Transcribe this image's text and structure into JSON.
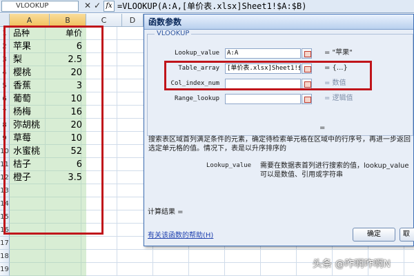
{
  "formula_bar": {
    "name_box": "VLOOKUP",
    "cancel_glyph": "✕",
    "confirm_glyph": "✓",
    "fx_label": "fx",
    "formula": "=VLOOKUP(A:A,[单价表.xlsx]Sheet1!$A:$B)"
  },
  "grid": {
    "columns": [
      "A",
      "B",
      "C",
      "D"
    ],
    "row_numbers": [
      "1",
      "2",
      "3",
      "4",
      "5",
      "6",
      "7",
      "8",
      "9",
      "10",
      "11",
      "12",
      "13",
      "14",
      "15",
      "16",
      "17",
      "18",
      "19"
    ],
    "rows": [
      {
        "a": "品种",
        "b": "单价"
      },
      {
        "a": "苹果",
        "b": "6"
      },
      {
        "a": "梨",
        "b": "2.5"
      },
      {
        "a": "樱桃",
        "b": "20"
      },
      {
        "a": "香蕉",
        "b": "3"
      },
      {
        "a": "葡萄",
        "b": "10"
      },
      {
        "a": "杨梅",
        "b": "16"
      },
      {
        "a": "弥胡桃",
        "b": "20"
      },
      {
        "a": "草莓",
        "b": "10"
      },
      {
        "a": "水蜜桃",
        "b": "52"
      },
      {
        "a": "桔子",
        "b": "6"
      },
      {
        "a": "橙子",
        "b": "3.5"
      }
    ]
  },
  "dialog": {
    "title": "函数参数",
    "group_label": "VLOOKUP",
    "args": [
      {
        "label": "Lookup_value",
        "value": "A:A",
        "result": "= \"苹果\""
      },
      {
        "label": "Table_array",
        "value": "[单价表.xlsx]Sheet1!$A:$B",
        "result": "= {...}"
      },
      {
        "label": "Col_index_num",
        "value": "",
        "result": "= 数值"
      },
      {
        "label": "Range_lookup",
        "value": "",
        "result": "= 逻辑值"
      }
    ],
    "equals_sign": "=",
    "description": "搜索表区域首列满足条件的元素，确定待检索单元格在区域中的行序号，再进一步返回选定单元格的值。情况下，表是以升序排序的",
    "param_name": "Lookup_value",
    "param_help": "需要在数据表首列进行搜索的值，lookup_value 可以是数值、引用或字符串",
    "calc_result": "计算结果 =",
    "help_link": "有关该函数的帮助(H)",
    "ok": "确定",
    "cancel": "取消"
  },
  "watermark": "头条 @咋啊咋啊N",
  "colors": {
    "highlight_box": "#c0141a",
    "selection_fill": "#a8d6a0",
    "dialog_bg": "#e8eef7"
  }
}
